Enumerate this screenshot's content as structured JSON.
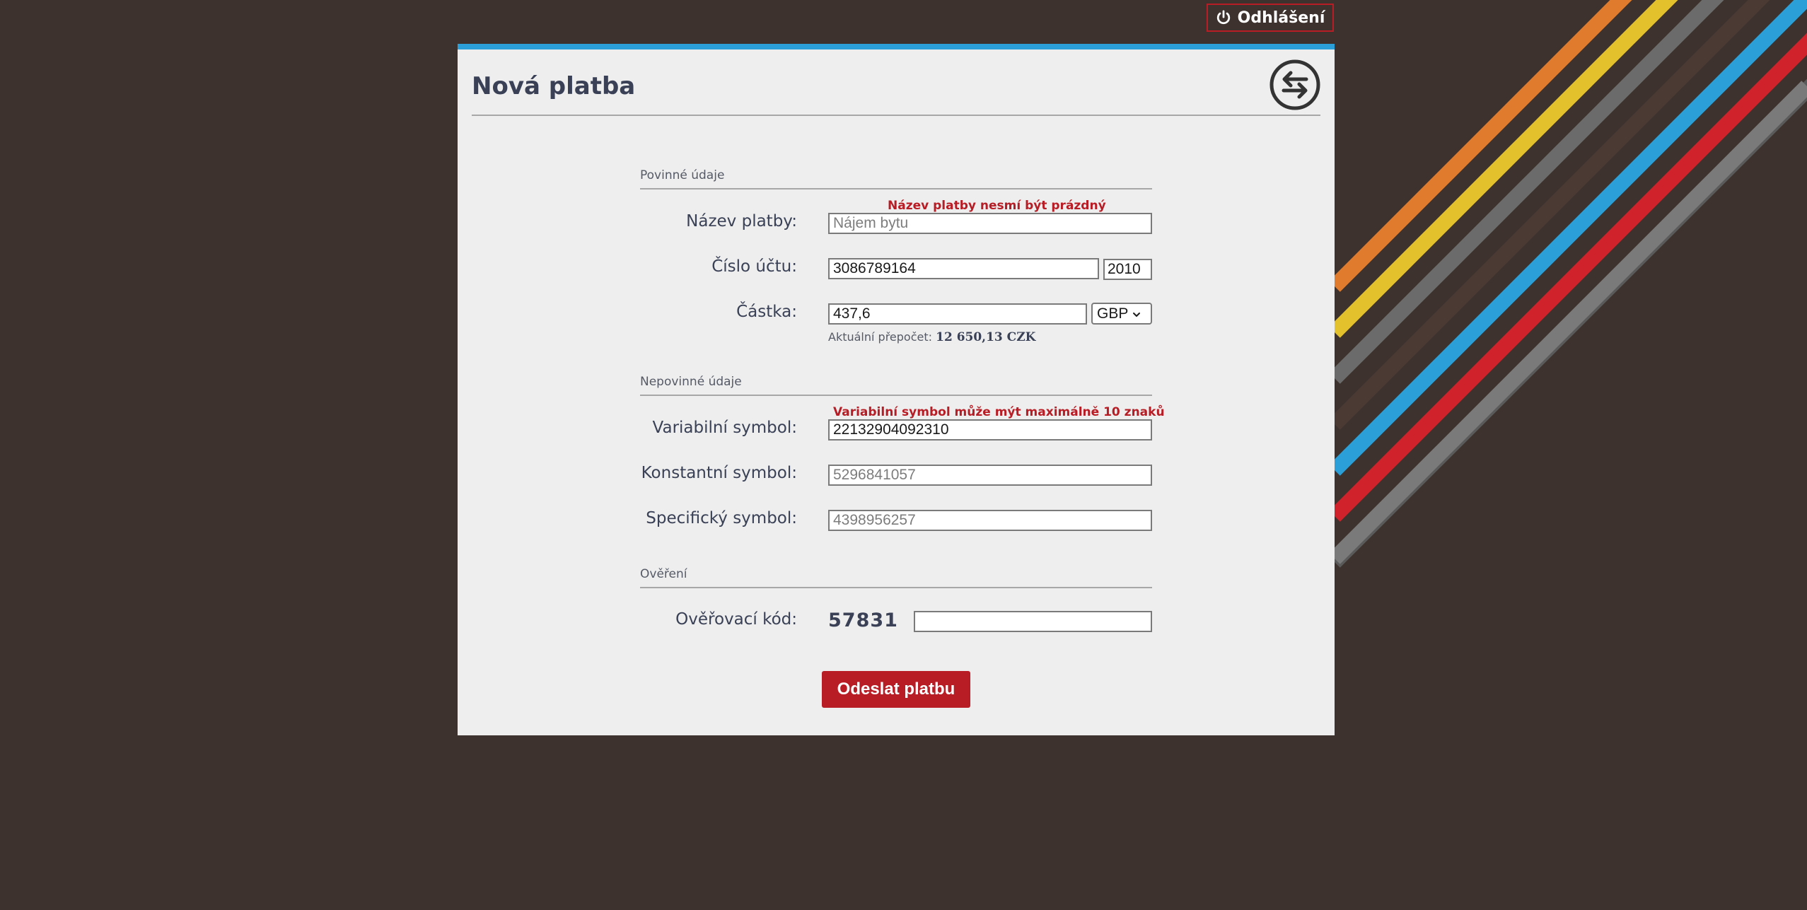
{
  "header": {
    "logout_label": "Odhlášení"
  },
  "page": {
    "title": "Nová platba"
  },
  "sections": {
    "required": "Povinné údaje",
    "optional": "Nepovinné údaje",
    "verification": "Ověření"
  },
  "form": {
    "payment_name": {
      "label": "Název platby:",
      "value": "",
      "placeholder": "Nájem bytu",
      "error": "Název platby nesmí být prázdný"
    },
    "account_number": {
      "label": "Číslo účtu:",
      "value": "3086789164",
      "bank_code": "2010"
    },
    "amount": {
      "label": "Částka:",
      "value": "437,6",
      "currency": "GBP",
      "conversion_label": "Aktuální přepočet:",
      "conversion_value": "12 650,13 CZK"
    },
    "variable_symbol": {
      "label": "Variabilní symbol:",
      "value": "22132904092310",
      "error": "Variabilní symbol může mýt maximálně 10 znaků"
    },
    "constant_symbol": {
      "label": "Konstantní symbol:",
      "value": "",
      "placeholder": "5296841057"
    },
    "specific_symbol": {
      "label": "Specifický symbol:",
      "value": "",
      "placeholder": "4398956257"
    },
    "verification": {
      "label": "Ověřovací kód:",
      "code": "57831",
      "value": ""
    },
    "submit_label": "Odeslat platbu"
  },
  "icons": {
    "power": "power-icon",
    "swap": "swap-arrows-icon",
    "dropdown": "chevron-down-icon"
  },
  "colors": {
    "background": "#3d322d",
    "accent_blue": "#2a9fd8",
    "brand_red": "#b81c24",
    "card": "#eeeeee",
    "text": "#3a4156",
    "stripes": [
      "#e07b2e",
      "#e3c12c",
      "#6b6b6b",
      "#4a3a33",
      "#2a9fd8",
      "#d0222a",
      "#5a5a5a",
      "#7a7a7a"
    ]
  }
}
